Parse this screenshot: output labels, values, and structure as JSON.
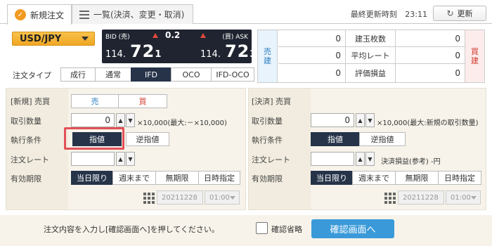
{
  "tabs": {
    "new_order": "新規注文",
    "list": "一覧(決済、変更・取消)"
  },
  "header": {
    "last_update_label": "最終更新時刻",
    "last_update_time": "23:11",
    "refresh_label": "更新"
  },
  "pair": "USD/JPY",
  "price": {
    "bid_label": "BID (売)",
    "ask_label": "(買) ASK",
    "spread": "0.2",
    "bid": {
      "prefix": "114.",
      "big": "72",
      "small": "1"
    },
    "ask": {
      "prefix": "114.",
      "big": "72",
      "small": "3"
    }
  },
  "position": {
    "sell_label": "売建",
    "buy_label": "買建",
    "rows": [
      {
        "label": "建玉枚数",
        "sell": "0",
        "buy": "0"
      },
      {
        "label": "平均レート",
        "sell": "0",
        "buy": "0"
      },
      {
        "label": "評価損益",
        "sell": "0",
        "buy": "0"
      }
    ]
  },
  "order_type": {
    "label": "注文タイプ",
    "options": [
      "成行",
      "通常",
      "IFD",
      "OCO",
      "IFD-OCO"
    ],
    "selected": "IFD"
  },
  "new_panel": {
    "side_label": "[新規] 売買",
    "sell": "売",
    "buy": "買",
    "qty_label": "取引数量",
    "qty_value": "0",
    "qty_note": "×10,000(最大:－×10,000)",
    "exec_label": "執行条件",
    "exec_options": [
      "指値",
      "逆指値"
    ],
    "rate_label": "注文レート",
    "expiry_label": "有効期限",
    "expiry_options": [
      "当日限り",
      "週末まで",
      "無期限",
      "日時指定"
    ],
    "date": "20211228",
    "time": "01:00"
  },
  "settle_panel": {
    "side_label": "[決済] 売買",
    "qty_label": "取引数量",
    "qty_value": "0",
    "qty_note": "×10,000(最大:新規の取引数量)",
    "exec_label": "執行条件",
    "exec_options": [
      "指値",
      "逆指値"
    ],
    "rate_label": "注文レート",
    "pl_note": "決済損益(参考) -円",
    "expiry_label": "有効期限",
    "expiry_options": [
      "当日限り",
      "週末まで",
      "無期限",
      "日時指定"
    ],
    "date": "20211228",
    "time": "01:00"
  },
  "footer": {
    "instruction": "注文内容を入力し[確認画面へ]を押してください。",
    "skip_confirm_label": "確認省略",
    "confirm_button": "確認画面へ"
  },
  "colors": {
    "accent_orange": "#f29a1f",
    "selected_navy": "#263349",
    "confirm_blue": "#3a9ad9",
    "highlight_red": "#e35058",
    "sell_blue": "#2d7fc1",
    "buy_red": "#d0392f"
  }
}
